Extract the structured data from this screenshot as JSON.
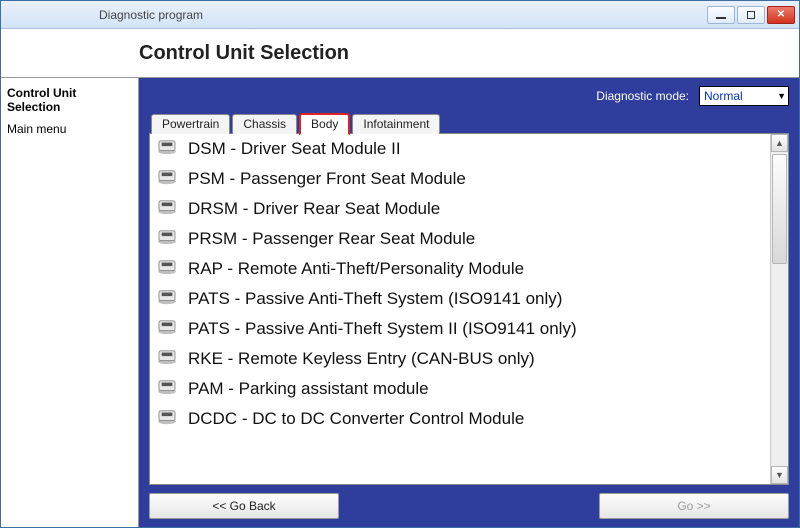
{
  "window": {
    "title": "Diagnostic program"
  },
  "page": {
    "title": "Control Unit Selection"
  },
  "sidebar": {
    "items": [
      {
        "label": "Control Unit Selection",
        "bold": true
      },
      {
        "label": "Main menu",
        "bold": false
      }
    ]
  },
  "mode": {
    "label": "Diagnostic mode:",
    "value": "Normal"
  },
  "tabs": [
    {
      "label": "Powertrain",
      "active": false
    },
    {
      "label": "Chassis",
      "active": false
    },
    {
      "label": "Body",
      "active": true
    },
    {
      "label": "Infotainment",
      "active": false
    }
  ],
  "modules": [
    {
      "label": "DSM - Driver Seat Module II"
    },
    {
      "label": "PSM - Passenger Front Seat Module"
    },
    {
      "label": "DRSM - Driver Rear Seat Module"
    },
    {
      "label": "PRSM - Passenger Rear Seat Module"
    },
    {
      "label": "RAP - Remote Anti-Theft/Personality Module"
    },
    {
      "label": "PATS - Passive Anti-Theft System (ISO9141 only)"
    },
    {
      "label": "PATS - Passive Anti-Theft System II (ISO9141 only)"
    },
    {
      "label": "RKE - Remote Keyless Entry (CAN-BUS only)"
    },
    {
      "label": "PAM - Parking assistant module"
    },
    {
      "label": "DCDC - DC to DC Converter Control Module"
    }
  ],
  "footer": {
    "back": "<< Go Back",
    "go": "Go >>"
  }
}
